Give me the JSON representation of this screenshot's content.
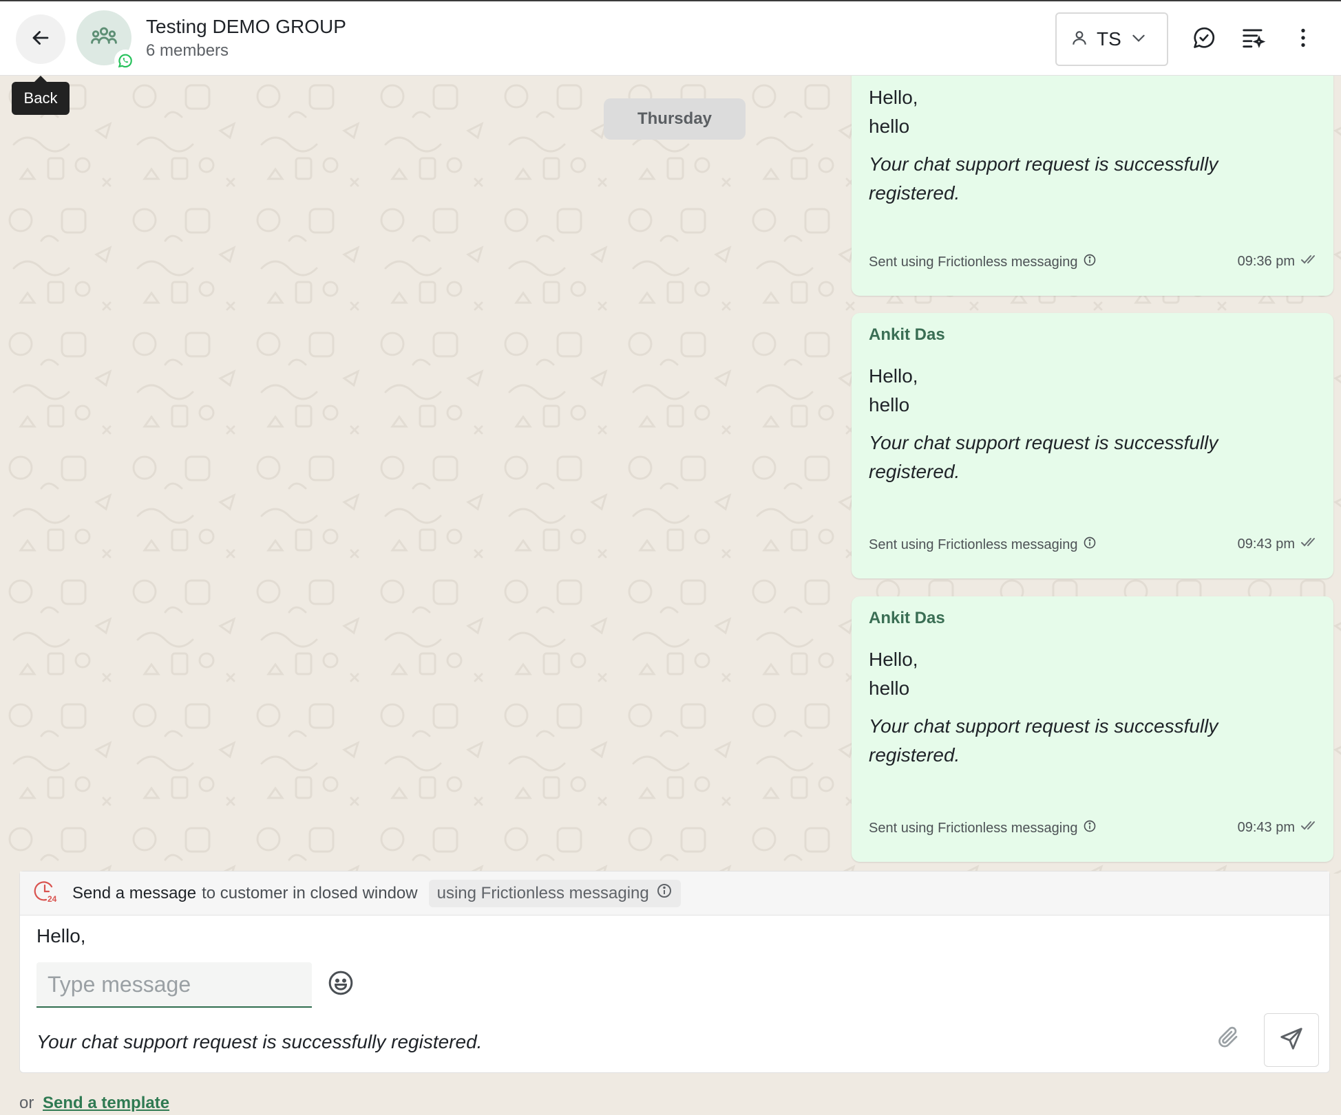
{
  "header": {
    "title": "Testing DEMO GROUP",
    "subtitle": "6 members",
    "agent_initials": "TS",
    "back_tooltip": "Back",
    "accent_color": "#2f6d4e"
  },
  "chat": {
    "date_label": "Thursday",
    "messages": [
      {
        "sender": "",
        "line1": "Hello,",
        "line2": "hello",
        "italic": "Your chat support request is successfully registered.",
        "footer": "Sent using Frictionless messaging",
        "time": "09:36 pm"
      },
      {
        "sender": "Ankit Das",
        "line1": "Hello,",
        "line2": "hello",
        "italic": "Your chat support request is successfully registered.",
        "footer": "Sent using Frictionless messaging",
        "time": "09:43 pm"
      },
      {
        "sender": "Ankit Das",
        "line1": "Hello,",
        "line2": "hello",
        "italic": "Your chat support request is successfully registered.",
        "footer": "Sent using Frictionless messaging",
        "time": "09:43 pm"
      }
    ]
  },
  "composer": {
    "bar_strong": "Send a message",
    "bar_muted": "to customer in closed window",
    "bar_chip": "using Frictionless messaging",
    "template_hello": "Hello,",
    "input_placeholder": "Type message",
    "template_italic": "Your chat support request is successfully registered.",
    "or_text": "or",
    "send_template_link": "Send a template"
  }
}
